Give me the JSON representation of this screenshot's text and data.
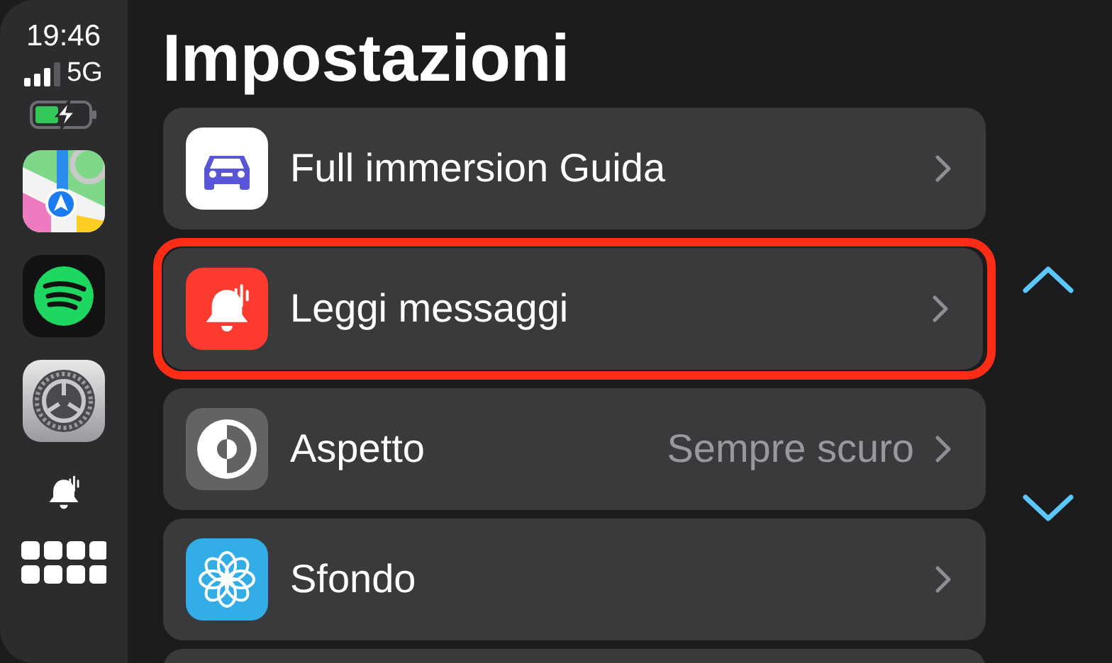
{
  "status": {
    "time": "19:46",
    "network": "5G"
  },
  "dock": [
    {
      "kind": "maps"
    },
    {
      "kind": "music"
    },
    {
      "kind": "settings"
    },
    {
      "kind": "bell"
    },
    {
      "kind": "grid"
    }
  ],
  "title": "Impostazioni",
  "rows": [
    {
      "kind": "car",
      "label": "Full immersion Guida",
      "highlighted": false
    },
    {
      "kind": "bell",
      "label": "Leggi messaggi",
      "highlighted": true
    },
    {
      "kind": "appearance",
      "label": "Aspetto",
      "value": "Sempre scuro",
      "highlighted": false
    },
    {
      "kind": "wallpaper",
      "label": "Sfondo",
      "highlighted": false
    }
  ]
}
